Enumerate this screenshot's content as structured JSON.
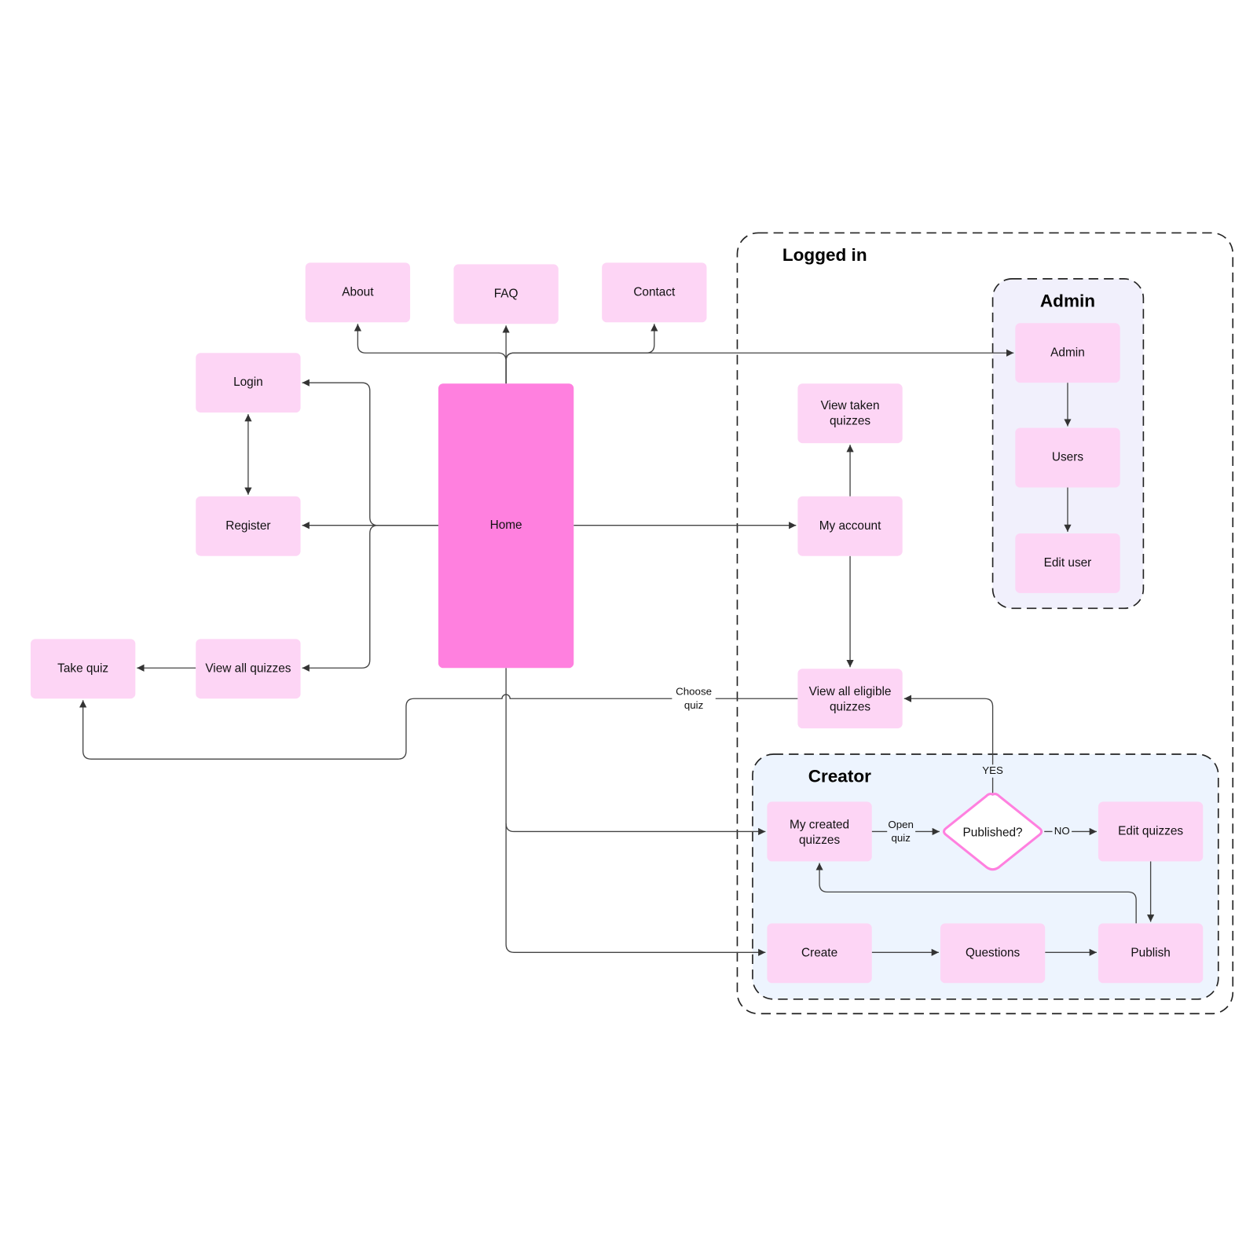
{
  "colors": {
    "node": "#fdd5f5",
    "home": "#ff80df",
    "decision_border": "#ff80df",
    "admin_group": "#f1f0fc",
    "creator_group": "#edf4fe",
    "edge": "#444444"
  },
  "groups": {
    "logged_in": "Logged in",
    "admin": "Admin",
    "creator": "Creator"
  },
  "nodes": {
    "about": "About",
    "faq": "FAQ",
    "contact": "Contact",
    "login": "Login",
    "register": "Register",
    "home": "Home",
    "view_all_quizzes": "View all quizzes",
    "take_quiz": "Take quiz",
    "view_taken": [
      "View taken",
      "quizzes"
    ],
    "my_account": "My account",
    "view_eligible": [
      "View all eligible",
      "quizzes"
    ],
    "admin": "Admin",
    "users": "Users",
    "edit_user": "Edit user",
    "my_created": [
      "My created",
      "quizzes"
    ],
    "published": "Published?",
    "edit_quizzes": "Edit quizzes",
    "create": "Create",
    "questions": "Questions",
    "publish": "Publish"
  },
  "edge_labels": {
    "choose_quiz": [
      "Choose",
      "quiz"
    ],
    "open_quiz": [
      "Open",
      "quiz"
    ],
    "yes": "YES",
    "no": "NO"
  }
}
